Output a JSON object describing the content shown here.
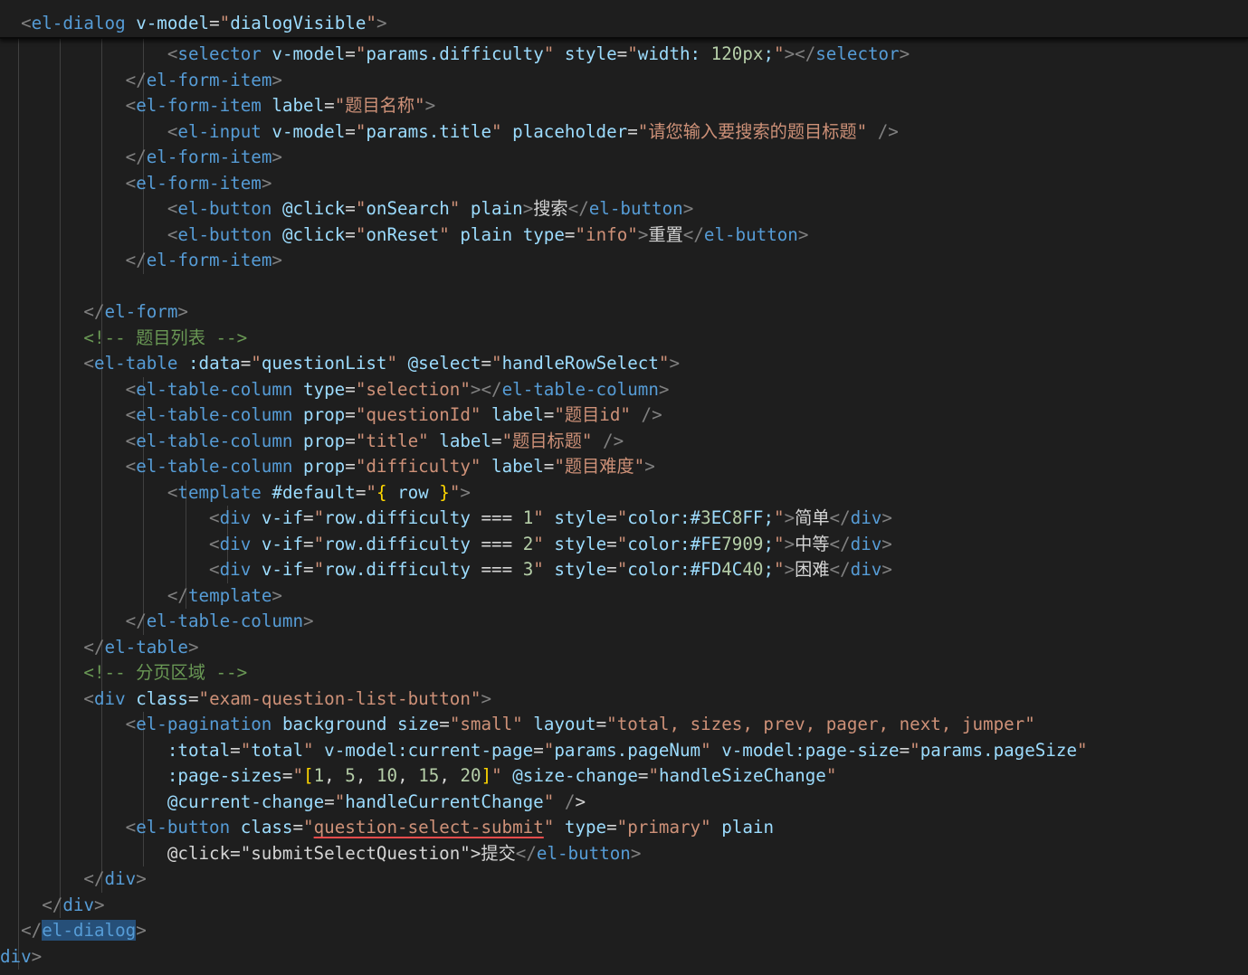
{
  "editor": {
    "background": "#1e1e1e",
    "sticky_header": "  <el-dialog v-model=\"dialogVisible\">",
    "top_fragment": "iv>",
    "lines": [
      "                <selector v-model=\"params.difficulty\" style=\"width: 120px;\"></selector>",
      "            </el-form-item>",
      "            <el-form-item label=\"题目名称\">",
      "                <el-input v-model=\"params.title\" placeholder=\"请您输入要搜索的题目标题\" />",
      "            </el-form-item>",
      "            <el-form-item>",
      "                <el-button @click=\"onSearch\" plain>搜索</el-button>",
      "                <el-button @click=\"onReset\" plain type=\"info\">重置</el-button>",
      "            </el-form-item>",
      "",
      "        </el-form>",
      "        <!-- 题目列表 -->",
      "        <el-table :data=\"questionList\" @select=\"handleRowSelect\">",
      "            <el-table-column type=\"selection\"></el-table-column>",
      "            <el-table-column prop=\"questionId\" label=\"题目id\" />",
      "            <el-table-column prop=\"title\" label=\"题目标题\" />",
      "            <el-table-column prop=\"difficulty\" label=\"题目难度\">",
      "                <template #default=\"{ row }\">",
      "                    <div v-if=\"row.difficulty === 1\" style=\"color:#3EC8FF;\">简单</div>",
      "                    <div v-if=\"row.difficulty === 2\" style=\"color:#FE7909;\">中等</div>",
      "                    <div v-if=\"row.difficulty === 3\" style=\"color:#FD4C40;\">困难</div>",
      "                </template>",
      "            </el-table-column>",
      "        </el-table>",
      "        <!-- 分页区域 -->",
      "        <div class=\"exam-question-list-button\">",
      "            <el-pagination background size=\"small\" layout=\"total, sizes, prev, pager, next, jumper\"",
      "                :total=\"total\" v-model:current-page=\"params.pageNum\" v-model:page-size=\"params.pageSize\"",
      "                :page-sizes=\"[1, 5, 10, 15, 20]\" @size-change=\"handleSizeChange\"",
      "                @current-change=\"handleCurrentChange\" />",
      "            <el-button class=\"question-select-submit\" type=\"primary\" plain",
      "                @click=\"submitSelectQuestion\">提交</el-button>",
      "        </div>",
      "    </div>",
      "  </el-dialog>",
      "div>"
    ]
  },
  "colors": {
    "tag": "#569cd6",
    "bracket": "#808080",
    "attribute": "#9cdcfe",
    "string": "#ce9178",
    "number": "#b5cea8",
    "comment": "#6a9955",
    "text": "#d4d4d4",
    "curly": "#ffd700",
    "squiggle": "#f14c4c",
    "selection": "#264f78"
  }
}
